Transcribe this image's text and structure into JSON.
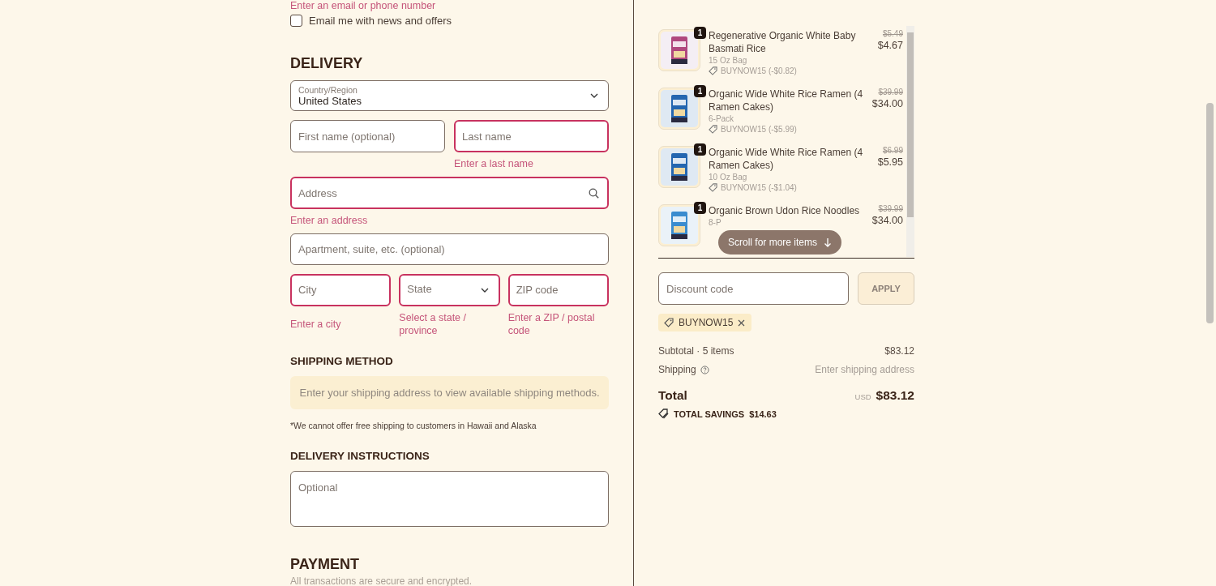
{
  "contact": {
    "error": "Enter an email or phone number",
    "newsletter": {
      "label": "Email me with news and offers",
      "checked": false
    }
  },
  "delivery": {
    "heading": "DELIVERY",
    "country": {
      "label": "Country/Region",
      "value": "United States"
    },
    "name_row": [
      {
        "placeholder": "First name (optional)",
        "invalid": false
      },
      {
        "placeholder": "Last name",
        "invalid": true,
        "error": "Enter a last name"
      }
    ],
    "address": {
      "placeholder": "Address",
      "invalid": true,
      "error": "Enter an address"
    },
    "apartment": {
      "placeholder": "Apartment, suite, etc. (optional)",
      "invalid": false
    },
    "city_row": [
      {
        "kind": "input",
        "placeholder": "City",
        "invalid": true,
        "error": "Enter a city"
      },
      {
        "kind": "select",
        "placeholder": "State",
        "invalid": true,
        "error": "Select a state / province"
      },
      {
        "kind": "input",
        "placeholder": "ZIP code",
        "invalid": true,
        "error": "Enter a ZIP / postal code"
      }
    ]
  },
  "shipping_method": {
    "heading": "SHIPPING METHOD",
    "notice": "Enter your shipping address to view available shipping methods.",
    "note": "*We cannot offer free shipping to customers in Hawaii and Alaska"
  },
  "delivery_instructions": {
    "heading": "DELIVERY INSTRUCTIONS",
    "placeholder": "Optional"
  },
  "payment": {
    "heading": "PAYMENT",
    "subtitle": "All transactions are secure and encrypted."
  },
  "cart": {
    "items": [
      {
        "quantity": "1",
        "name": "Regenerative Organic White Baby Basmati Rice",
        "variant": "15 Oz Bag",
        "discount": "BUYNOW15 (-$0.82)",
        "old_price": "$5.49",
        "price": "$4.67"
      },
      {
        "quantity": "1",
        "name": "Organic Wide White Rice Ramen (4 Ramen Cakes)",
        "variant": "6-Pack",
        "discount": "BUYNOW15 (-$5.99)",
        "old_price": "$39.99",
        "price": "$34.00"
      },
      {
        "quantity": "1",
        "name": "Organic Wide White Rice Ramen (4 Ramen Cakes)",
        "variant": "10 Oz Bag",
        "discount": "BUYNOW15 (-$1.04)",
        "old_price": "$6.99",
        "price": "$5.95"
      },
      {
        "quantity": "1",
        "name": "Organic Brown Udon Rice Noodles",
        "variant": "8-P",
        "old_price": "$39.99",
        "price": "$34.00"
      }
    ],
    "scroll_hint": "Scroll for more items"
  },
  "discount": {
    "placeholder": "Discount code",
    "button": "APPLY",
    "applied_code": "BUYNOW15"
  },
  "summary": {
    "subtotal_label": "Subtotal · 5 items",
    "subtotal": "$83.12",
    "shipping_label": "Shipping",
    "shipping_value": "Enter shipping address",
    "total_label": "Total",
    "currency": "USD",
    "total": "$83.12",
    "savings_label": "TOTAL SAVINGS",
    "savings": "$14.63"
  }
}
